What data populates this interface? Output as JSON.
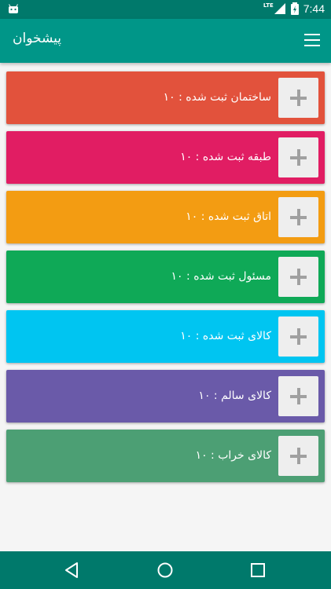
{
  "status_bar": {
    "time": "7:44",
    "network": "LTE"
  },
  "appbar": {
    "title": "پیشخوان",
    "menu_icon": "menu-icon"
  },
  "cards": [
    {
      "label": "ساختمان ثبت شده :  ۱۰",
      "color": "#e2523c"
    },
    {
      "label": "طبقه ثبت شده :  ۱۰",
      "color": "#e11d63"
    },
    {
      "label": "اتاق ثبت شده :  ۱۰",
      "color": "#f39c12"
    },
    {
      "label": "مسئول ثبت شده :  ۱۰",
      "color": "#0fa957"
    },
    {
      "label": "کالای ثبت شده :  ۱۰",
      "color": "#00c5f1"
    },
    {
      "label": "کالای سالم :  ۱۰",
      "color": "#6a5aa9"
    },
    {
      "label": "کالای خراب :  ۱۰",
      "color": "#4c9f74"
    }
  ],
  "nav_bar": {
    "icons": [
      "back-icon",
      "home-icon",
      "recents-icon"
    ]
  }
}
